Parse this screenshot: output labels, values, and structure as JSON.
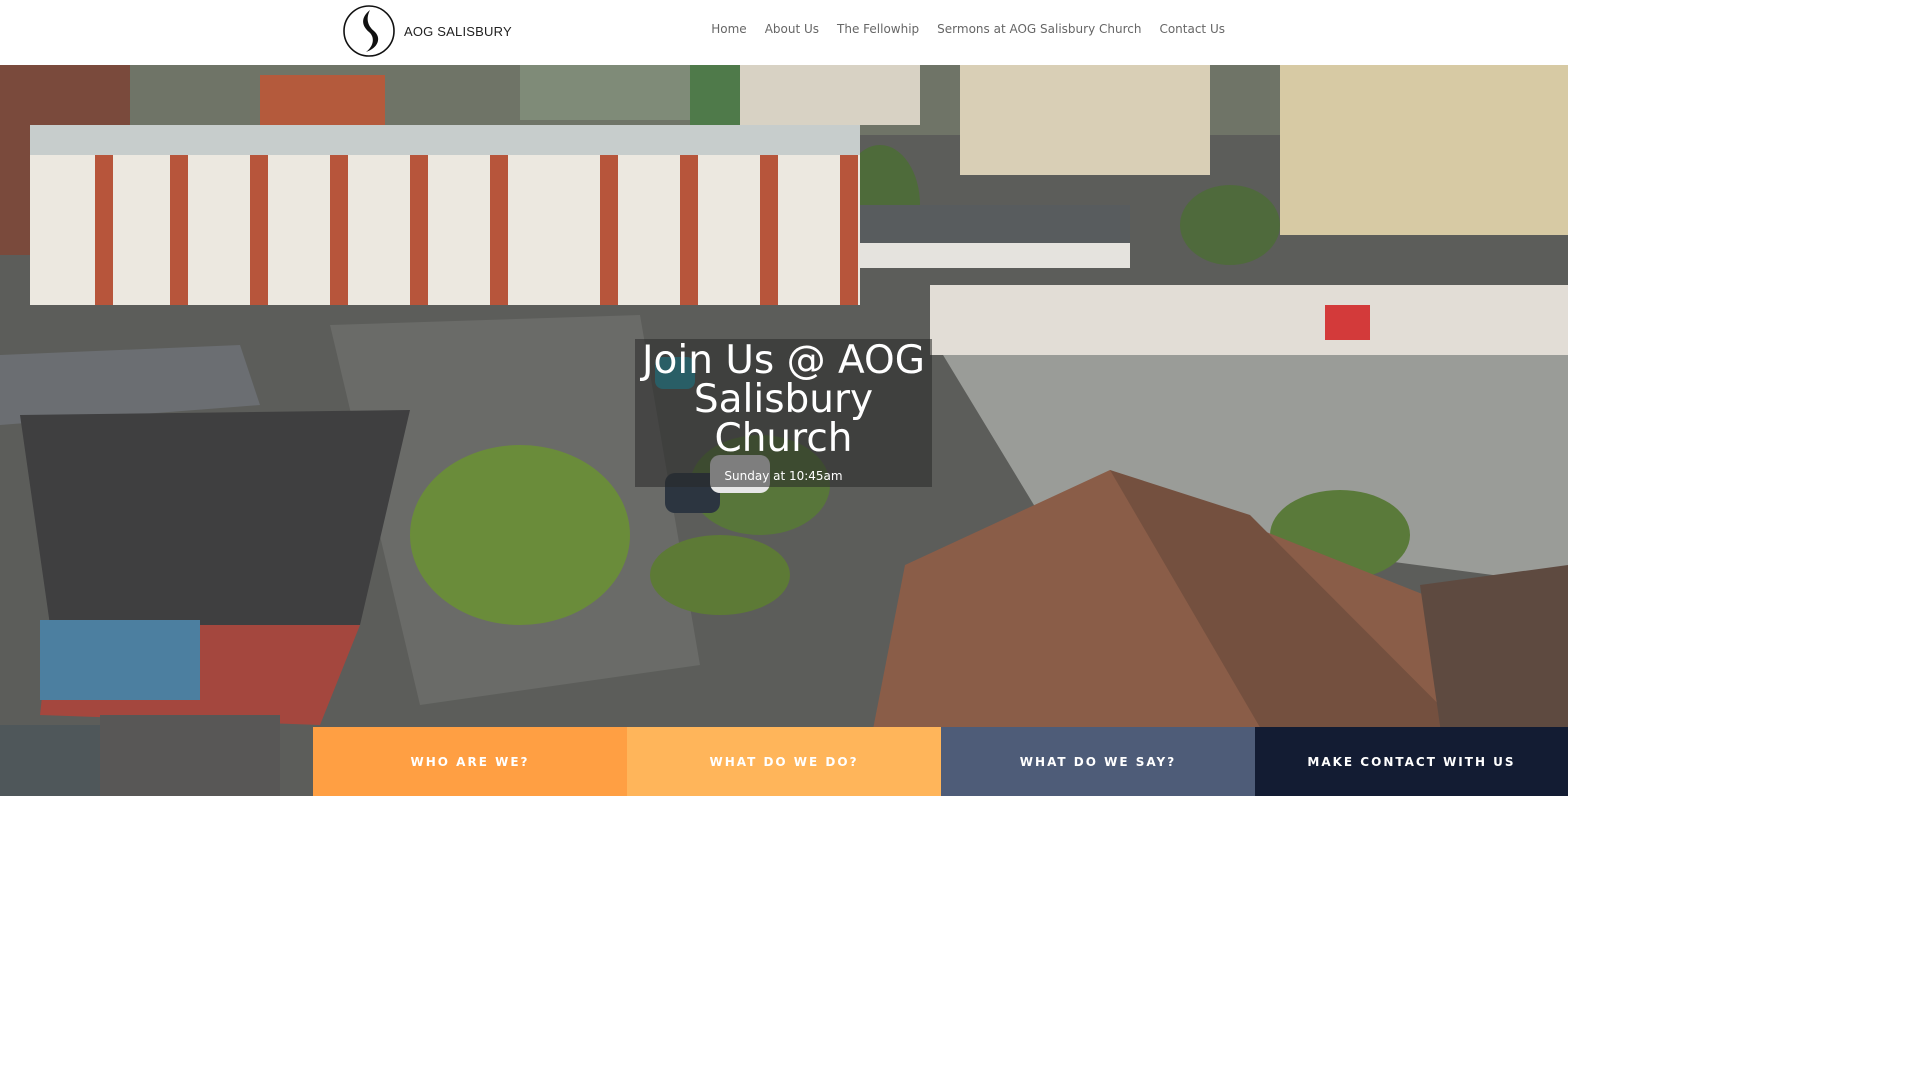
{
  "brand": {
    "name": "AOG SALISBURY",
    "logo_icon": "flame-icon"
  },
  "nav": {
    "items": [
      {
        "label": "Home"
      },
      {
        "label": "About Us"
      },
      {
        "label": "The Fellowhip"
      },
      {
        "label": "Sermons at AOG Salisbury Church"
      },
      {
        "label": "Contact Us"
      }
    ]
  },
  "hero": {
    "title": "Join Us @ AOG Salisbury Church",
    "subtitle": "Sunday at 10:45am"
  },
  "cta": [
    {
      "label": "WHO ARE WE?",
      "color": "#FF9F43"
    },
    {
      "label": "WHAT DO WE DO?",
      "color": "#FFB55A"
    },
    {
      "label": "WHAT DO WE SAY?",
      "color": "#4E5C78"
    },
    {
      "label": "MAKE CONTACT WITH US",
      "color": "#131C33"
    }
  ]
}
